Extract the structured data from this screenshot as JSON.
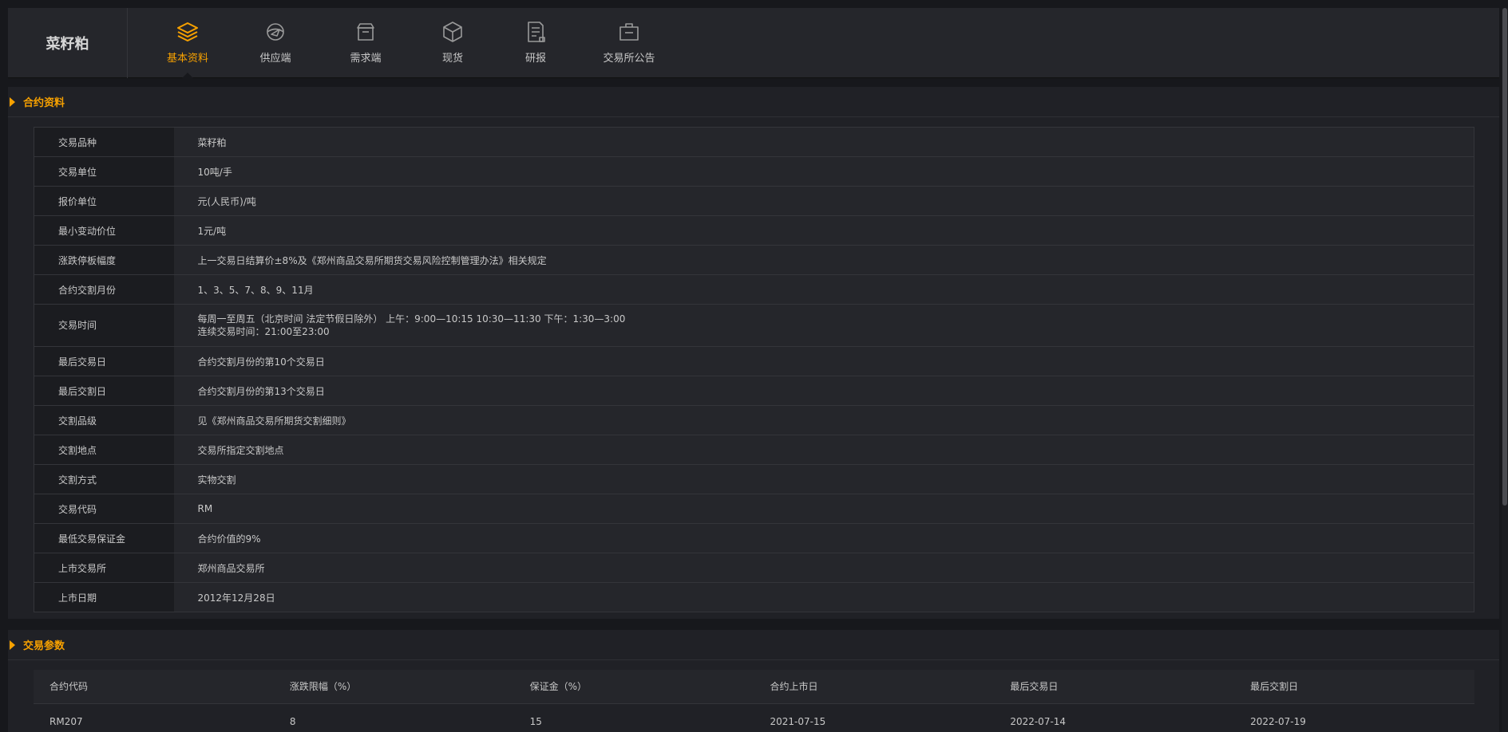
{
  "product": "菜籽粕",
  "tabs": [
    {
      "label": "基本资料",
      "icon": "layers-icon",
      "active": true
    },
    {
      "label": "供应端",
      "icon": "globe-plane-icon",
      "active": false
    },
    {
      "label": "需求端",
      "icon": "storage-box-icon",
      "active": false
    },
    {
      "label": "现货",
      "icon": "cube-icon",
      "active": false
    },
    {
      "label": "研报",
      "icon": "report-icon",
      "active": false
    },
    {
      "label": "交易所公告",
      "icon": "briefcase-icon",
      "active": false
    }
  ],
  "contract_section": {
    "title": "合约资料",
    "rows": [
      {
        "key": "交易品种",
        "value": "菜籽粕"
      },
      {
        "key": "交易单位",
        "value": "10吨/手"
      },
      {
        "key": "报价单位",
        "value": "元(人民币)/吨"
      },
      {
        "key": "最小变动价位",
        "value": "1元/吨"
      },
      {
        "key": "涨跌停板幅度",
        "value": "上一交易日结算价±8%及《郑州商品交易所期货交易风险控制管理办法》相关规定"
      },
      {
        "key": "合约交割月份",
        "value": "1、3、5、7、8、9、11月"
      },
      {
        "key": "交易时间",
        "value": "每周一至周五（北京时间 法定节假日除外） 上午：9:00—10:15 10:30—11:30 下午：1:30—3:00",
        "value2": "连续交易时间：21:00至23:00"
      },
      {
        "key": "最后交易日",
        "value": "合约交割月份的第10个交易日"
      },
      {
        "key": "最后交割日",
        "value": "合约交割月份的第13个交易日"
      },
      {
        "key": "交割品级",
        "value": "见《郑州商品交易所期货交割细则》"
      },
      {
        "key": "交割地点",
        "value": "交易所指定交割地点"
      },
      {
        "key": "交割方式",
        "value": "实物交割"
      },
      {
        "key": "交易代码",
        "value": "RM"
      },
      {
        "key": "最低交易保证金",
        "value": "合约价值的9%"
      },
      {
        "key": "上市交易所",
        "value": "郑州商品交易所"
      },
      {
        "key": "上市日期",
        "value": "2012年12月28日"
      }
    ]
  },
  "params_section": {
    "title": "交易参数",
    "headers": [
      "合约代码",
      "涨跌限幅（%）",
      "保证金（%）",
      "合约上市日",
      "最后交易日",
      "最后交割日"
    ],
    "rows": [
      [
        "RM207",
        "8",
        "15",
        "2021-07-15",
        "2022-07-14",
        "2022-07-19"
      ]
    ]
  },
  "colors": {
    "accent": "#f7a100",
    "bg": "#17181c",
    "panel": "#202126"
  }
}
